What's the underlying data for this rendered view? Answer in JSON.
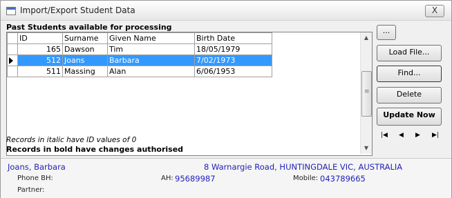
{
  "window": {
    "title": "Import/Export Student Data",
    "close_label": "X"
  },
  "grid": {
    "caption": "Past Students available for processing",
    "columns": [
      "ID",
      "Surname",
      "Given Name",
      "Birth Date"
    ],
    "rows": [
      {
        "id": "165",
        "surname": "Dawson",
        "given": "Tim",
        "birth": "18/05/1979"
      },
      {
        "id": "512",
        "surname": "Joans",
        "given": "Barbara",
        "birth": "7/02/1973"
      },
      {
        "id": "511",
        "surname": "Massing",
        "given": "Alan",
        "birth": "6/06/1953"
      }
    ],
    "selected_row": 1
  },
  "notes": {
    "italic": "Records in italic have ID values of 0",
    "bold": "Records in bold have changes authorised"
  },
  "buttons": {
    "ellipsis": "...",
    "load_file": "Load File...",
    "find": "Find...",
    "delete": "Delete",
    "update_now": "Update Now"
  },
  "nav": {
    "first": "|◀",
    "prev": "◀",
    "next": "▶",
    "last": "▶|"
  },
  "details": {
    "name": "Joans, Barbara",
    "address": "8 Warnargie Road, HUNTINGDALE VIC, AUSTRALIA",
    "phone_bh_label": "Phone BH:",
    "phone_bh_value": "",
    "ah_label": "AH:",
    "ah_value": "95689987",
    "mobile_label": "Mobile:",
    "mobile_value": "043789665",
    "partner_label": "Partner:",
    "partner_value": ""
  },
  "colors": {
    "selection": "#3399ff",
    "detail_text": "#1f1fb8"
  }
}
